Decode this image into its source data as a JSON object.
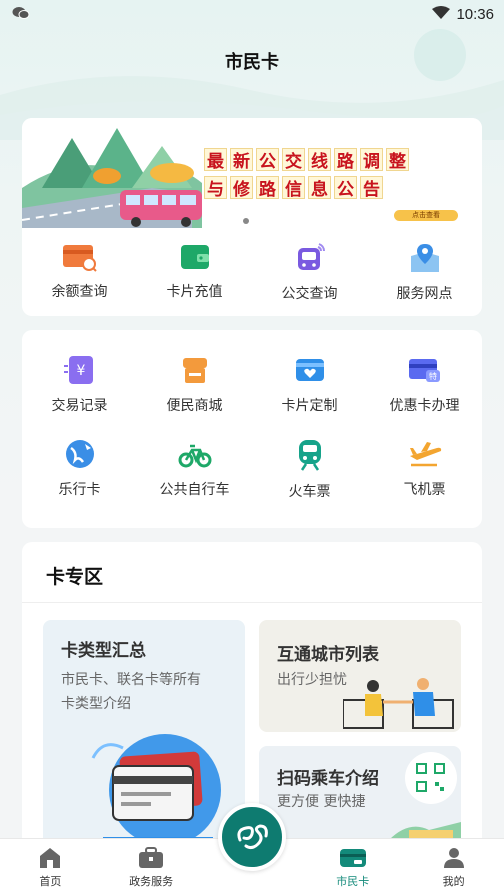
{
  "status_bar": {
    "time": "10:36",
    "notification_icon": "wechat-icon",
    "wifi_icon": "wifi-icon",
    "battery_icon": "battery-icon"
  },
  "app_title": "市民卡",
  "banner": {
    "line1": [
      "最",
      "新",
      "公",
      "交",
      "线",
      "路",
      "调",
      "整"
    ],
    "line2": [
      "与",
      "修",
      "路",
      "信",
      "息",
      "公",
      "告"
    ],
    "button": "点击查看"
  },
  "quick_actions": [
    {
      "label": "余额查询",
      "icon": "balance-search-icon"
    },
    {
      "label": "卡片充值",
      "icon": "wallet-icon"
    },
    {
      "label": "公交查询",
      "icon": "bus-icon"
    },
    {
      "label": "服务网点",
      "icon": "location-pin-icon"
    }
  ],
  "services_row1": [
    {
      "label": "交易记录",
      "icon": "yuan-receipt-icon"
    },
    {
      "label": "便民商城",
      "icon": "shop-icon"
    },
    {
      "label": "卡片定制",
      "icon": "card-heart-icon"
    },
    {
      "label": "优惠卡办理",
      "icon": "discount-card-icon"
    }
  ],
  "services_row2": [
    {
      "label": "乐行卡",
      "icon": "globe-plane-icon"
    },
    {
      "label": "公共自行车",
      "icon": "bicycle-icon"
    },
    {
      "label": "火车票",
      "icon": "train-icon"
    },
    {
      "label": "飞机票",
      "icon": "airplane-icon"
    }
  ],
  "card_zone": {
    "title": "卡专区",
    "tile_a": {
      "title": "卡类型汇总",
      "desc1": "市民卡、联名卡等所有",
      "desc2": "卡类型介绍"
    },
    "tile_b": {
      "title": "互通城市列表",
      "desc": "出行少担忧"
    },
    "tile_c": {
      "title": "扫码乘车介绍",
      "desc": "更方便  更快捷"
    }
  },
  "tabbar": {
    "tabs": [
      {
        "label": "首页",
        "icon": "home-icon"
      },
      {
        "label": "政务服务",
        "icon": "briefcase-icon"
      },
      {
        "label": "市民卡",
        "icon": "card-icon"
      },
      {
        "label": "我的",
        "icon": "user-icon"
      }
    ],
    "active": "市民卡",
    "center_icon": "brand-logo-icon"
  },
  "colors": {
    "accent": "#138a7a",
    "banner_red": "#c8141e",
    "orange": "#f07a3c",
    "green": "#1ea868",
    "purple": "#7a5ae0",
    "blue": "#3a8ee6"
  }
}
